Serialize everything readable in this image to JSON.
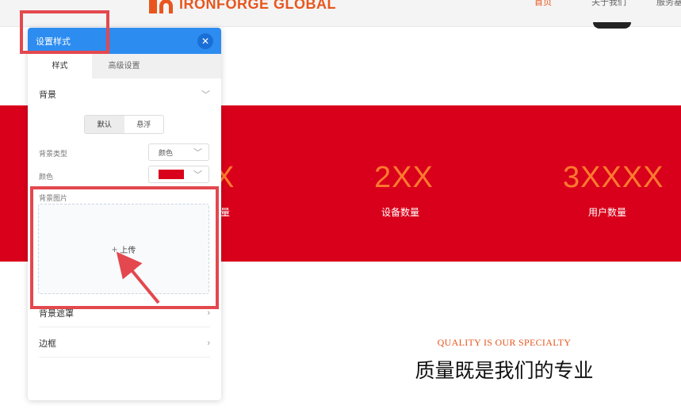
{
  "site": {
    "logo_text": "IRONFORGE GLOBAL",
    "nav": [
      "首页",
      "关于我们",
      "服务基"
    ],
    "stats": [
      {
        "value": "X",
        "label": "量"
      },
      {
        "value": "2XX",
        "label": "设备数量"
      },
      {
        "value": "3XXXX",
        "label": "用户数量"
      }
    ],
    "quality_en": "QUALITY IS OUR SPECIALTY",
    "quality_cn": "质量既是我们的专业"
  },
  "panel": {
    "title": "设置样式",
    "close_icon": "close-icon",
    "tabs": [
      "样式",
      "高级设置"
    ],
    "active_tab": 0,
    "background_section": "背景",
    "mode_options": [
      "默认",
      "悬浮"
    ],
    "active_mode": 0,
    "bg_type_label": "背景类型",
    "bg_type_value": "颜色",
    "color_label": "颜色",
    "color_value": "#d9001b",
    "bg_image_label": "背景图片",
    "upload_label": "上传",
    "mask_section": "背景遮罩",
    "border_section": "边框"
  },
  "colors": {
    "accent": "#2d8cf0",
    "brand": "#e8561e",
    "banner": "#d9001b",
    "annotation": "#e3484e"
  }
}
